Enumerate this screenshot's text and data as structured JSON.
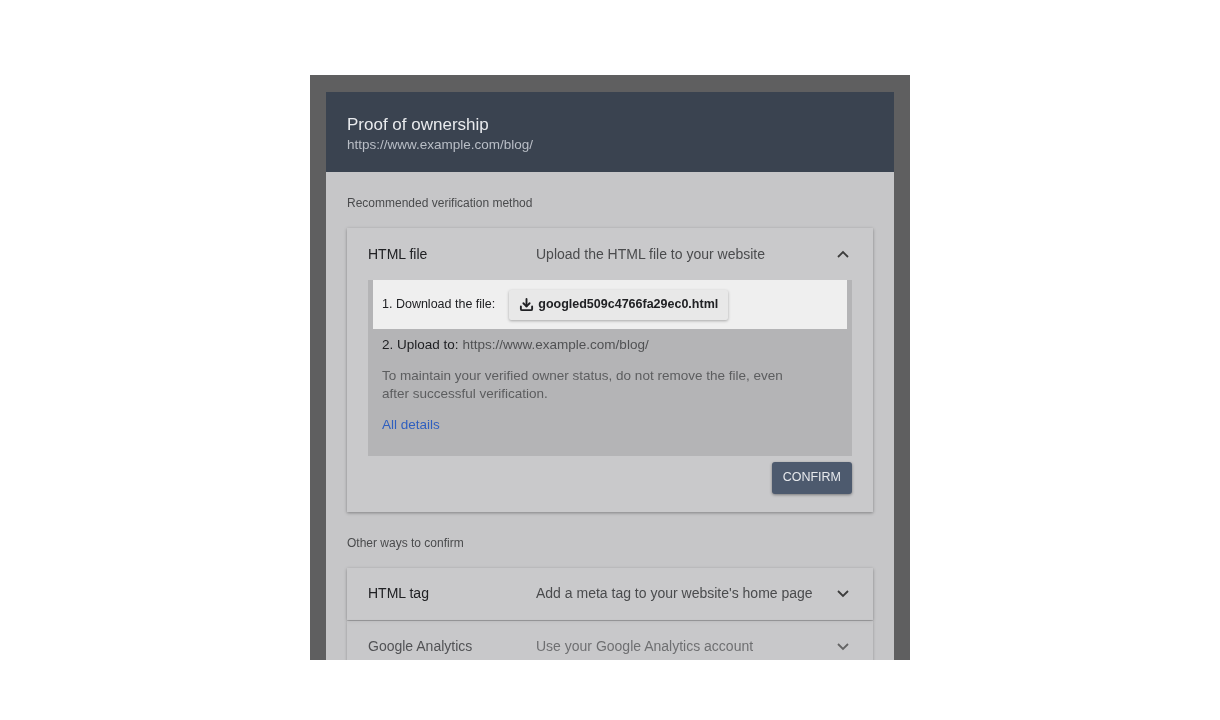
{
  "dialog": {
    "title": "Proof of ownership",
    "subtitle": "https://www.example.com/blog/"
  },
  "recommended": {
    "heading": "Recommended verification method",
    "methods": [
      {
        "name": "HTML file",
        "description": "Upload the HTML file to your website",
        "expanded": true,
        "download_label": "1. Download the file:",
        "file_button": "googled509c4766fa29ec0.html",
        "upload_label": "2. Upload to:",
        "upload_url": "https://www.example.com/blog/",
        "note": "To maintain your verified owner status, do not remove the file, even after successful verification.",
        "link": "All details",
        "confirm": "CONFIRM"
      }
    ]
  },
  "other": {
    "heading": "Other ways to confirm",
    "methods": [
      {
        "name": "HTML tag",
        "description": "Add a meta tag to your website's home page",
        "expanded": false
      },
      {
        "name": "Google Analytics",
        "description": "Use your Google Analytics account",
        "expanded": false
      }
    ]
  }
}
